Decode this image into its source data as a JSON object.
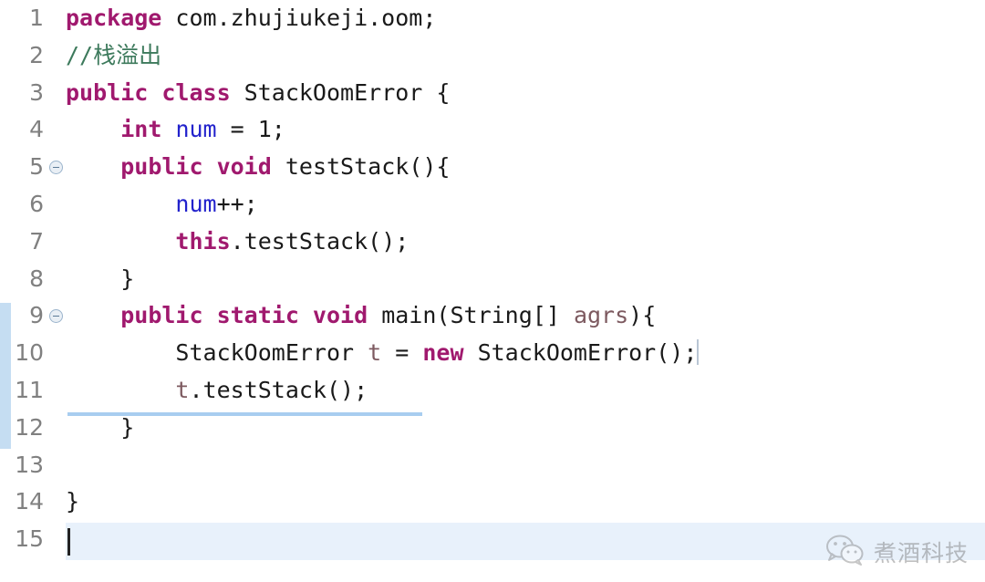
{
  "editor": {
    "language": "java",
    "colors": {
      "background": "#ffffff",
      "keyword": "#a0196e",
      "comment": "#3d7a5c",
      "field_variable": "#2222cc",
      "local_variable": "#7d5a60",
      "plain_text": "#1a1a1a",
      "line_number": "#808080",
      "current_line_highlight": "#e8f1fb",
      "change_bar": "#c5ddf2",
      "fold_underline": "#a8cdf0"
    },
    "gutter": {
      "fold_marker_icon": "collapse-circle-minus-icon",
      "fold_marker_lines": [
        5,
        9
      ]
    },
    "lines": [
      {
        "number": "1",
        "fold": false,
        "tokens": [
          {
            "t": "package",
            "c": "kw"
          },
          {
            "t": " com.zhujiukeji.oom;",
            "c": "plain"
          }
        ]
      },
      {
        "number": "2",
        "fold": false,
        "tokens": [
          {
            "t": "//栈溢出",
            "c": "cmt"
          }
        ]
      },
      {
        "number": "3",
        "fold": false,
        "tokens": [
          {
            "t": "public class",
            "c": "kw"
          },
          {
            "t": " StackOomError {",
            "c": "plain"
          }
        ]
      },
      {
        "number": "4",
        "fold": false,
        "tokens": [
          {
            "t": "    ",
            "c": "plain"
          },
          {
            "t": "int",
            "c": "kw"
          },
          {
            "t": " ",
            "c": "plain"
          },
          {
            "t": "num",
            "c": "var"
          },
          {
            "t": " = 1;",
            "c": "plain"
          }
        ]
      },
      {
        "number": "5",
        "fold": true,
        "tokens": [
          {
            "t": "    ",
            "c": "plain"
          },
          {
            "t": "public void",
            "c": "kw"
          },
          {
            "t": " testStack(){",
            "c": "plain"
          }
        ]
      },
      {
        "number": "6",
        "fold": false,
        "tokens": [
          {
            "t": "        ",
            "c": "plain"
          },
          {
            "t": "num",
            "c": "var"
          },
          {
            "t": "++;",
            "c": "plain"
          }
        ]
      },
      {
        "number": "7",
        "fold": false,
        "tokens": [
          {
            "t": "        ",
            "c": "plain"
          },
          {
            "t": "this",
            "c": "kw"
          },
          {
            "t": ".testStack();",
            "c": "plain"
          }
        ]
      },
      {
        "number": "8",
        "fold": false,
        "tokens": [
          {
            "t": "    }",
            "c": "plain"
          }
        ]
      },
      {
        "number": "9",
        "fold": true,
        "tokens": [
          {
            "t": "    ",
            "c": "plain"
          },
          {
            "t": "public static void",
            "c": "kw"
          },
          {
            "t": " main(String[] ",
            "c": "plain"
          },
          {
            "t": "agrs",
            "c": "local"
          },
          {
            "t": "){",
            "c": "plain"
          }
        ]
      },
      {
        "number": "10",
        "fold": false,
        "tokens": [
          {
            "t": "        StackOomError ",
            "c": "plain"
          },
          {
            "t": "t",
            "c": "local"
          },
          {
            "t": " = ",
            "c": "plain"
          },
          {
            "t": "new",
            "c": "kw"
          },
          {
            "t": " StackOomError();",
            "c": "plain"
          }
        ]
      },
      {
        "number": "11",
        "fold": false,
        "tokens": [
          {
            "t": "        ",
            "c": "plain"
          },
          {
            "t": "t",
            "c": "local"
          },
          {
            "t": ".testStack();",
            "c": "plain"
          }
        ]
      },
      {
        "number": "12",
        "fold": false,
        "tokens": [
          {
            "t": "    }",
            "c": "plain"
          }
        ]
      },
      {
        "number": "13",
        "fold": false,
        "tokens": []
      },
      {
        "number": "14",
        "fold": false,
        "tokens": [
          {
            "t": "}",
            "c": "plain"
          }
        ]
      },
      {
        "number": "15",
        "fold": false,
        "tokens": []
      }
    ]
  },
  "watermark": {
    "icon": "wechat-logo-icon",
    "text": "煮酒科技"
  }
}
